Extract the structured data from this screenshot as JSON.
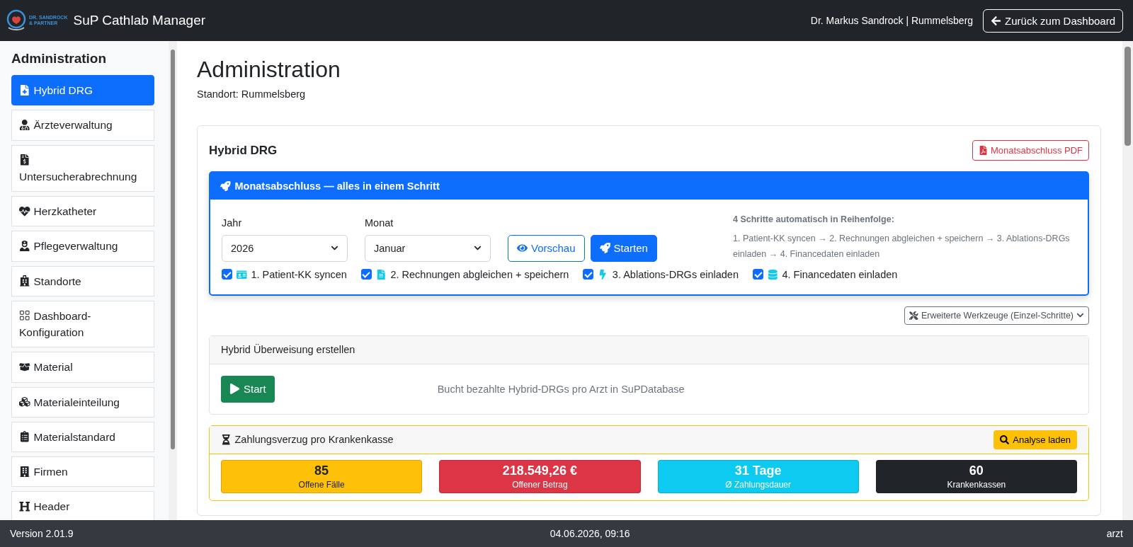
{
  "navbar": {
    "logo": {
      "line1": "DR. SANDROCK",
      "line2": "& PARTNER"
    },
    "title": "SuP Cathlab Manager",
    "user": "Dr. Markus Sandrock | Rummelsberg",
    "back_button": "Zurück zum Dashboard"
  },
  "sidebar": {
    "title": "Administration",
    "items": [
      {
        "label": "Hybrid DRG",
        "selected": true
      },
      {
        "label": "Ärzteverwaltung",
        "selected": false
      },
      {
        "label": "Untersucherabrechnung",
        "selected": false
      },
      {
        "label": "Herzkatheter",
        "selected": false
      },
      {
        "label": "Pflegeverwaltung",
        "selected": false
      },
      {
        "label": "Standorte",
        "selected": false
      },
      {
        "label": "Dashboard-Konfiguration",
        "selected": false
      },
      {
        "label": "Material",
        "selected": false
      },
      {
        "label": "Materialeinteilung",
        "selected": false
      },
      {
        "label": "Materialstandard",
        "selected": false
      },
      {
        "label": "Firmen",
        "selected": false
      },
      {
        "label": "Header",
        "selected": false
      }
    ]
  },
  "page": {
    "title": "Administration",
    "subtitle": "Standort: Rummelsberg"
  },
  "card": {
    "title": "Hybrid DRG",
    "pdf_button": "Monatsabschluss PDF",
    "month_close": {
      "header": "Monatsabschluss — alles in einem Schritt",
      "year": {
        "label": "Jahr",
        "value": "2026"
      },
      "month": {
        "label": "Monat",
        "value": "Januar"
      },
      "preview_button": "Vorschau",
      "start_button": "Starten",
      "info_title": "4 Schritte automatisch in Reihenfolge:",
      "info_text": "1. Patient-KK syncen → 2. Rechnungen abgleichen + speichern → 3. Ablations-DRGs einladen → 4. Financedaten einladen",
      "steps": [
        {
          "label": "1. Patient-KK syncen",
          "checked": true
        },
        {
          "label": "2. Rechnungen abgleichen + speichern",
          "checked": true
        },
        {
          "label": "3. Ablations-DRGs einladen",
          "checked": true
        },
        {
          "label": "4. Financedaten einladen",
          "checked": true
        }
      ]
    },
    "tools_button": "Erweiterte Werkzeuge (Einzel-Schritte)",
    "transfer": {
      "header": "Hybrid Überweisung erstellen",
      "start_button": "Start",
      "description": "Bucht bezahlte Hybrid-DRGs pro Arzt in SuPDatabase"
    },
    "delay": {
      "header": "Zahlungsverzug pro Krankenkasse",
      "button": "Analyse laden",
      "stats": [
        {
          "value": "85",
          "label": "Offene Fälle",
          "color": "#ffc107"
        },
        {
          "value": "218.549,26 €",
          "label": "Offener Betrag",
          "color": "#dc3545"
        },
        {
          "value": "31 Tage",
          "label": "Ø Zahlungsdauer",
          "color": "#0dcaf0"
        },
        {
          "value": "60",
          "label": "Krankenkassen",
          "color": "#212529"
        }
      ]
    }
  },
  "footer": {
    "version": "Version 2.01.9",
    "datetime": "04.06.2026, 09:16",
    "user": "arzt"
  }
}
